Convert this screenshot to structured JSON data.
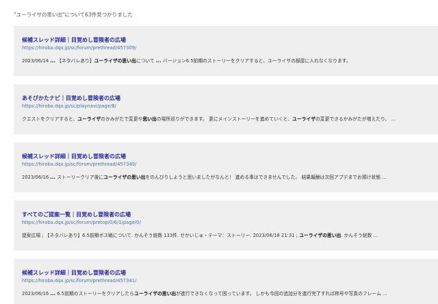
{
  "search": {
    "summary": "\"ユーライザの思い出\"について63件見つかりました"
  },
  "results": [
    {
      "title": "候補スレッド詳細｜目覚めし冒険者の広場",
      "url": "https://hiroba.dqx.jp/sc/forum/prethread/457309/",
      "snippet": [
        {
          "text": "2023/06/14 ",
          "hl": false
        },
        {
          "text": "...",
          "hl": true
        },
        {
          "text": " 【ネタバレあり】",
          "hl": false
        },
        {
          "text": "ユーライザの思い出",
          "hl": true
        },
        {
          "text": "について ",
          "hl": false
        },
        {
          "text": "...",
          "hl": true
        },
        {
          "text": " バージョン6.5前期のストーリーをクリアすると、ユーライザの部屋に入れなくなります。",
          "hl": false
        }
      ]
    },
    {
      "title": "あそびかたナビ｜目覚めし冒険者の広場",
      "url": "https://hiroba.dqx.jp/sc/playnavi/page/8/",
      "snippet": [
        {
          "text": "クエストをクリアすると、",
          "hl": false
        },
        {
          "text": "ユーライザ",
          "hl": true
        },
        {
          "text": "のかみがたで変更や",
          "hl": false
        },
        {
          "text": "思い出",
          "hl": true
        },
        {
          "text": "の場所巡りができます。 更にメインストーリーを進めていくと、",
          "hl": false
        },
        {
          "text": "ユーライザ",
          "hl": true
        },
        {
          "text": "の変更できるかみがたが増えたり、 ...",
          "hl": false
        }
      ]
    },
    {
      "title": "候補スレッド詳細｜目覚めし冒険者の広場",
      "url": "https://hiroba.dqx.jp/sc/forum/prethread/457349/",
      "snippet": [
        {
          "text": "2023/06/16 ",
          "hl": false
        },
        {
          "text": "...",
          "hl": true
        },
        {
          "text": " ストーリークリア後に",
          "hl": false
        },
        {
          "text": "ユーライザの思い出",
          "hl": true
        },
        {
          "text": "をのんびりしようと思いましたがなんと！ 進める事はできませんでした。 結果報酬は次回アプデまでお預け状態 ...",
          "hl": false
        }
      ]
    },
    {
      "title": "すべてのご提案一覧｜目覚めし冒険者の広場",
      "url": "https://hiroba.dqx.jp/sc/forum/pretop/0/6/1/page/0/",
      "snippet": [
        {
          "text": "提案広場 ; 【ネタバレあり】6.5前期ボス戦について. かんそう総数 133件. せかいじゅ・テーマ：ストーリー. 2023/06/18 21:31 ; ",
          "hl": false
        },
        {
          "text": "ユーライザの思い出",
          "hl": true
        },
        {
          "text": ". かんそう総数 ...",
          "hl": false
        }
      ]
    },
    {
      "title": "候補スレッド詳細｜目覚めし冒険者の広場",
      "url": "https://hiroba.dqx.jp/sc/forum/prethread/457341/",
      "snippet": [
        {
          "text": "2023/06/16 ",
          "hl": false
        },
        {
          "text": "...",
          "hl": true
        },
        {
          "text": " 6.5前期のストーリーをクリアしたら",
          "hl": false
        },
        {
          "text": "ユーライザの思い出",
          "hl": true
        },
        {
          "text": "が進行できなくなって困っています。 しかも今回の追加分を進行完了すれば称号や写真のフレーム ...",
          "hl": false
        }
      ]
    }
  ]
}
